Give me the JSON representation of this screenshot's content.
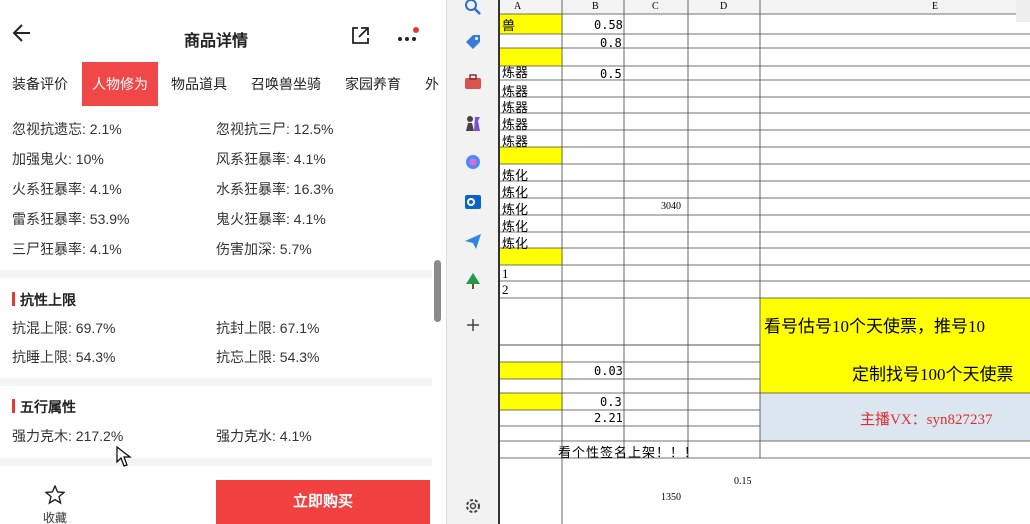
{
  "app": {
    "title": "商品详情",
    "tabs": [
      "装备评价",
      "人物修为",
      "物品道具",
      "召唤兽坐骑",
      "家园养育"
    ],
    "active_tab": 1
  },
  "stats_rows": [
    [
      "忽视抗遗忘: 2.1%",
      "忽视抗三尸: 12.5%"
    ],
    [
      "加强鬼火: 10%",
      "风系狂暴率: 4.1%"
    ],
    [
      "火系狂暴率: 4.1%",
      "水系狂暴率: 16.3%"
    ],
    [
      "雷系狂暴率: 53.9%",
      "鬼火狂暴率: 4.1%"
    ],
    [
      "三尸狂暴率: 4.1%",
      "伤害加深: 5.7%"
    ]
  ],
  "section_resist": {
    "title": "抗性上限",
    "rows": [
      [
        "抗混上限: 69.7%",
        "抗封上限: 67.1%"
      ],
      [
        "抗睡上限: 54.3%",
        "抗忘上限: 54.3%"
      ]
    ]
  },
  "section_elements": {
    "title": "五行属性",
    "rows": [
      [
        "强力克木: 217.2%",
        "强力克水: 4.1%"
      ]
    ]
  },
  "bottom": {
    "fav_label": "收藏",
    "buy_label": "立即购买"
  },
  "sheet": {
    "columns": [
      "A",
      "B",
      "C",
      "D",
      "E"
    ],
    "a_labels": [
      "兽",
      "",
      "",
      "",
      "炼器",
      "炼器",
      "炼器",
      "炼器",
      "炼器",
      "",
      "炼化",
      "炼化",
      "炼化",
      "炼化",
      "炼化",
      "",
      "1",
      "2"
    ],
    "b_values": [
      "0.58",
      "0.8",
      "",
      "",
      "0.5"
    ],
    "c_value": "3040",
    "b_value_2": "0.03",
    "b_value_3": "0.3",
    "b_value_4": "2.21",
    "banner_text": "看号估号10个天使票，推号10",
    "custom_text": "定制找号100个天使票",
    "contact_text": "主播VX：syn827237",
    "signature_text": "看个性签名上架！！！",
    "d_value": "0.15",
    "c_value_2": "1350",
    "colors": {
      "yellow": "#ffff00",
      "light_blue": "#dce6f1",
      "red_text": "#d83030"
    }
  }
}
